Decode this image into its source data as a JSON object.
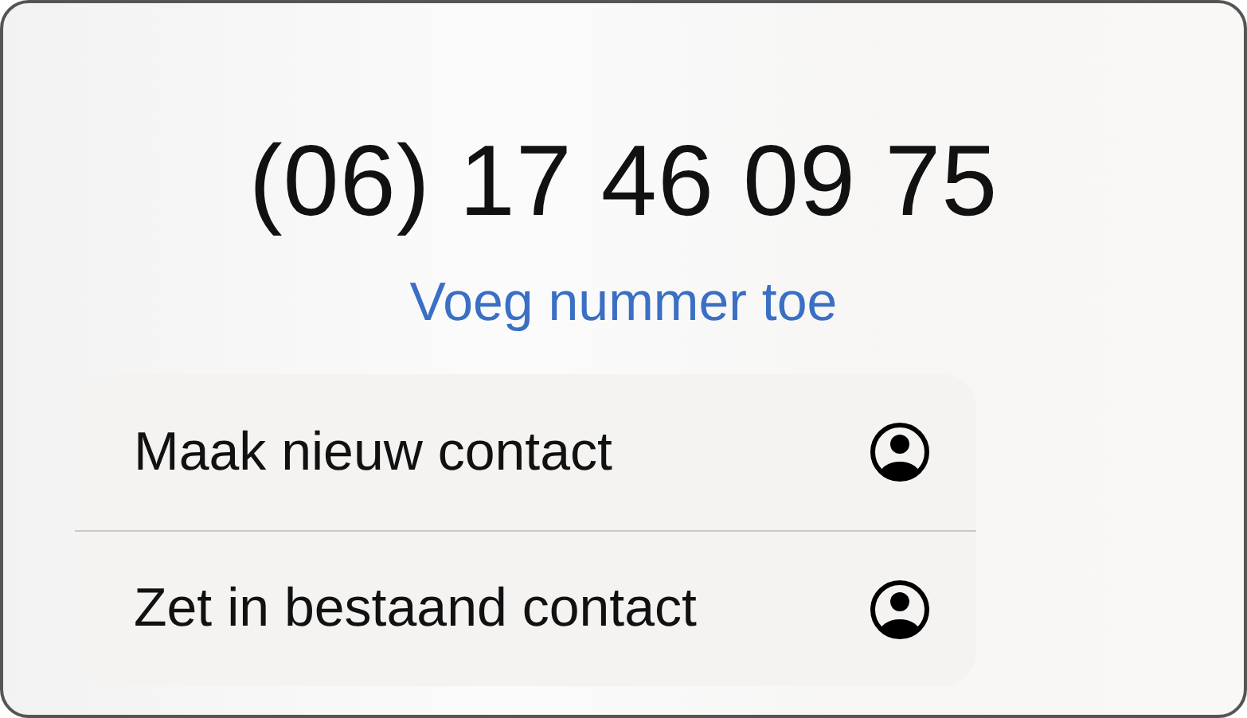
{
  "phone_number": "(06) 17 46 09 75",
  "add_number_link": "Voeg nummer toe",
  "menu": [
    {
      "label": "Maak nieuw contact"
    },
    {
      "label": "Zet in bestaand contact"
    }
  ]
}
